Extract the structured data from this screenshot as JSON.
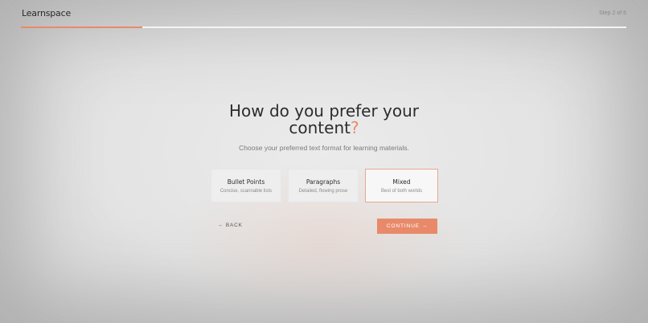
{
  "app": {
    "name": "Learnspace"
  },
  "header": {
    "step_text": "Step 2 of 6"
  },
  "progress": {
    "fraction": 0.2
  },
  "main": {
    "heading_line1": "How do you prefer your",
    "heading_line2": "content",
    "heading_mark": "?",
    "subtitle": "Choose your preferred text format for learning materials."
  },
  "options": [
    {
      "title": "Bullet Points",
      "description": "Concise, scannable lists",
      "selected": false
    },
    {
      "title": "Paragraphs",
      "description": "Detailed, flowing prose",
      "selected": false
    },
    {
      "title": "Mixed",
      "description": "Best of both worlds",
      "selected": true
    }
  ],
  "actions": {
    "back_label": "← BACK",
    "continue_label": "CONTINUE →"
  },
  "colors": {
    "accent": "#e88a6a",
    "text": "#2c2c2c",
    "muted": "#8a8a8a"
  }
}
